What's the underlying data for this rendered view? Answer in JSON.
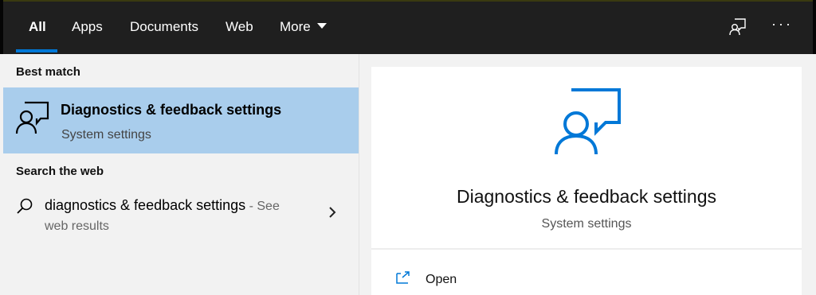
{
  "tabs": [
    {
      "label": "All",
      "active": true
    },
    {
      "label": "Apps"
    },
    {
      "label": "Documents"
    },
    {
      "label": "Web"
    },
    {
      "label": "More"
    }
  ],
  "header_icons": {
    "feedback": "feedback-icon",
    "more_options": "···"
  },
  "left": {
    "best_match_heading": "Best match",
    "best_match": {
      "title": "Diagnostics & feedback settings",
      "subtitle": "System settings",
      "icon": "diagnostics-feedback-icon"
    },
    "web_heading": "Search the web",
    "web_result": {
      "query": "diagnostics & feedback settings",
      "suffix": " - See",
      "line2": "web results",
      "icon": "search-icon"
    }
  },
  "preview": {
    "title": "Diagnostics & feedback settings",
    "subtitle": "System settings",
    "actions": [
      {
        "label": "Open",
        "icon": "open-icon"
      }
    ]
  },
  "colors": {
    "accent": "#0078d7",
    "selection": "#a9cdec",
    "topbar": "#1f1f1f"
  }
}
